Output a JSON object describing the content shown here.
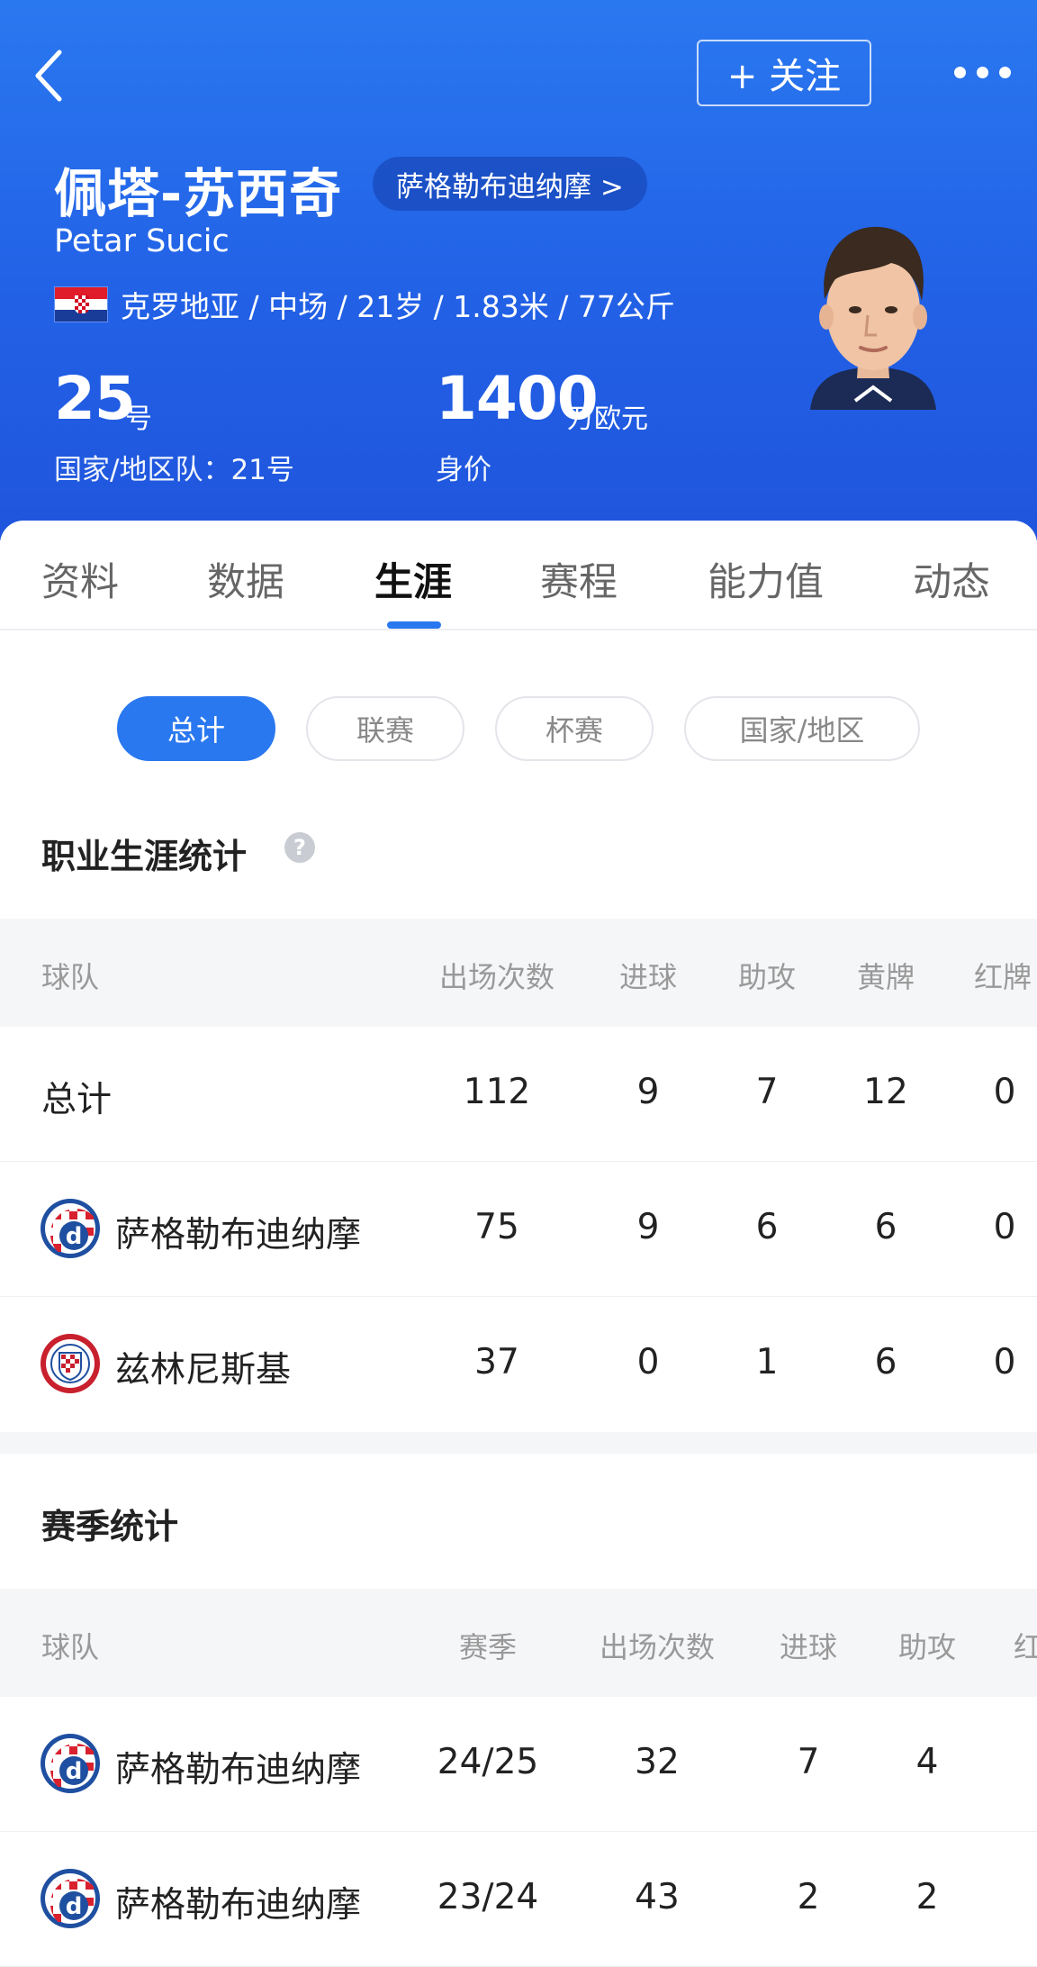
{
  "header": {
    "follow_label": "+ 关注",
    "name_cn": "佩塔-苏西奇",
    "club_link": "萨格勒布迪纳摩 >",
    "name_en": "Petar Sucic",
    "info": "克罗地亚 / 中场 / 21岁 / 1.83米 / 77公斤",
    "number": "25",
    "number_unit": "号",
    "national_number": "国家/地区队：21号",
    "value": "1400",
    "value_unit": "万欧元",
    "value_label": "身价",
    "colors": {
      "bg_top": "#2a78f0",
      "bg_bottom": "#1f55dd"
    }
  },
  "tabs": [
    "资料",
    "数据",
    "生涯",
    "赛程",
    "能力值",
    "动态"
  ],
  "active_tab": "生涯",
  "filters": [
    "总计",
    "联赛",
    "杯赛",
    "国家/地区"
  ],
  "active_filter": "总计",
  "career": {
    "title": "职业生涯统计",
    "headers": [
      "球队",
      "出场次数",
      "进球",
      "助攻",
      "黄牌",
      "红牌"
    ],
    "rows": [
      {
        "team": "总计",
        "apps": "112",
        "goals": "9",
        "assists": "7",
        "yellow": "12",
        "red": "0"
      },
      {
        "team": "萨格勒布迪纳摩",
        "apps": "75",
        "goals": "9",
        "assists": "6",
        "yellow": "6",
        "red": "0"
      },
      {
        "team": "兹林尼斯基",
        "apps": "37",
        "goals": "0",
        "assists": "1",
        "yellow": "6",
        "red": "0"
      }
    ]
  },
  "season": {
    "title": "赛季统计",
    "headers": [
      "球队",
      "赛季",
      "出场次数",
      "进球",
      "助攻",
      "红"
    ],
    "rows": [
      {
        "team": "萨格勒布迪纳摩",
        "season": "24/25",
        "apps": "32",
        "goals": "7",
        "assists": "4"
      },
      {
        "team": "萨格勒布迪纳摩",
        "season": "23/24",
        "apps": "43",
        "goals": "2",
        "assists": "2"
      }
    ]
  },
  "accent": "#2a78f0"
}
